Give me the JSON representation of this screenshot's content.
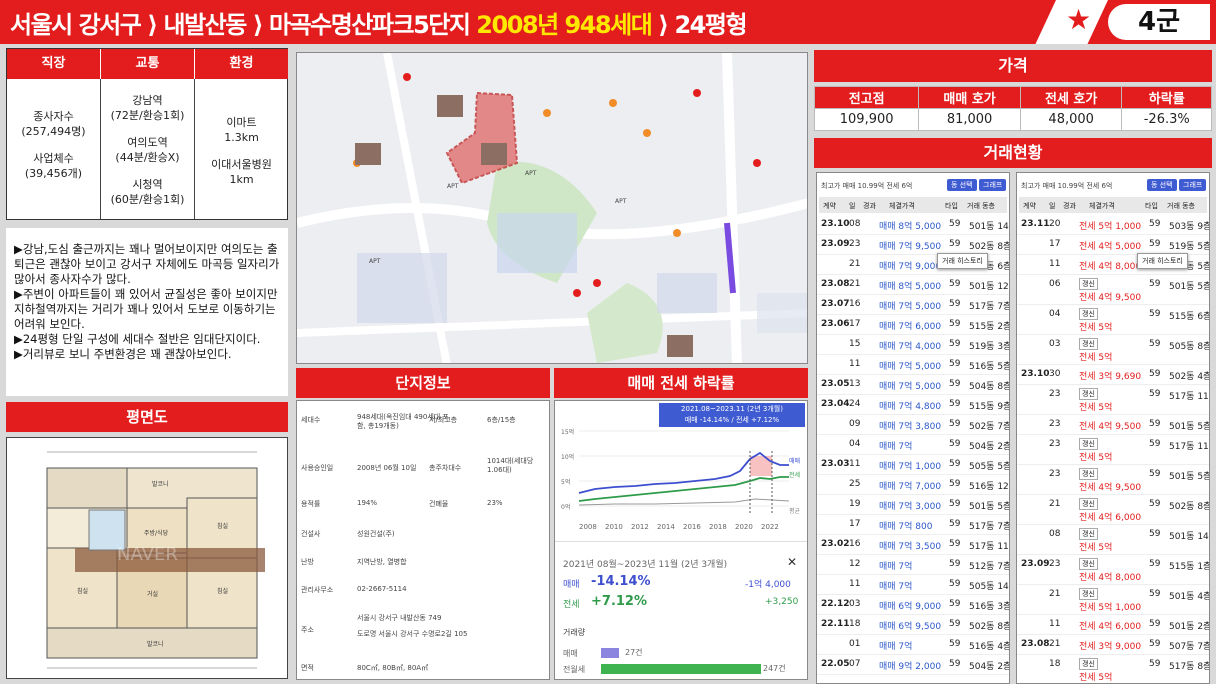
{
  "header": {
    "title_prefix": "서울시 강서구 ⟩ 내발산동 ⟩ 마곡수명산파크5단지 ",
    "title_highlight": "2008년 948세대",
    "title_suffix": " ⟩ 24평형",
    "group": "4군",
    "star": "★"
  },
  "colors": {
    "accent": "#e31d1d",
    "highlight": "#ffe800",
    "trade": "#2b57c9",
    "rent": "#1e8a3a"
  },
  "location": {
    "headers": [
      "직장",
      "교통",
      "환경"
    ],
    "work": [
      "종사자수",
      "(257,494명)",
      "사업체수",
      "(39,456개)"
    ],
    "transit": [
      "강남역",
      "(72분/환승1회)",
      "여의도역",
      "(44분/환승X)",
      "시청역",
      "(60분/환승1회)"
    ],
    "env": [
      "이마트",
      "1.3km",
      "이대서울병원",
      "1km"
    ]
  },
  "comment": "▶강남,도심 출근까지는 꽤나 멀어보이지만 여의도는 출퇴근은 괜찮아 보이고 강서구 자체에도 마곡등 일자리가 많아서 종사자수가 많다.\n▶주변이 아파트들이 꽤 있어서 균질성은 좋아 보이지만 지하철역까지는 거리가 꽤나 있어서 도보로 이동하기는 어려워 보인다.\n▶24평형 단일 구성에 세대수 절반은 임대단지이다.\n▶거리뷰로 보니 주변환경은 꽤 괜찮아보인다.",
  "floorplan": {
    "title": "평면도",
    "watermark": "NAVER"
  },
  "complex": {
    "title": "단지정보",
    "rows": [
      {
        "k": "세대수",
        "v": "948세대(옥진임대 490세대 포함, 총19개동)",
        "k2": "저/최고층",
        "v2": "6층/15층"
      },
      {
        "k": "사용승인일",
        "v": "2008년 06월 10일",
        "k2": "총주차대수",
        "v2": "1014대(세대당 1.06대)"
      },
      {
        "k": "용적률",
        "v": "194%",
        "k2": "건폐율",
        "v2": "23%"
      },
      {
        "k": "건설사",
        "v": "성원건설(주)",
        "k2": "",
        "v2": ""
      },
      {
        "k": "난방",
        "v": "지역난방, 열병합",
        "k2": "",
        "v2": ""
      },
      {
        "k": "관리사무소",
        "v": "02-2667-5114",
        "k2": "",
        "v2": ""
      },
      {
        "k": "주소",
        "v": "서울시 강서구 내발산동 749",
        "v3": "도로명 서울시 강서구 수명로2길 105",
        "k2": "",
        "v2": ""
      },
      {
        "k": "면적",
        "v": "80C㎡, 80B㎡, 80A㎡",
        "k2": "",
        "v2": ""
      }
    ]
  },
  "decline": {
    "title": "매매 전세 하락률",
    "period_badge": "2021.08~2023.11 (2년 3개월)",
    "badge_line2": "매매 -14.14% / 전세 +7.12%",
    "years": [
      "2008",
      "2010",
      "2012",
      "2014",
      "2016",
      "2018",
      "2020",
      "2022"
    ],
    "ylabels": [
      "15억",
      "10억",
      "5억",
      "0억"
    ],
    "legend": [
      "매매",
      "전세",
      "평균"
    ],
    "period": "2021년 08월~2023년 11월 (2년 3개월)",
    "close": "✕",
    "sale_label": "매매",
    "sale_pct": "-14.14%",
    "sale_amt": "-1억 4,000",
    "rent_label": "전세",
    "rent_pct": "+7.12%",
    "rent_amt": "+3,250",
    "volume_title": "거래량",
    "vol": [
      {
        "label": "매매",
        "count": "27건",
        "frac": 0.11
      },
      {
        "label": "전월세",
        "count": "247건",
        "frac": 1.0
      }
    ]
  },
  "price": {
    "title": "가격",
    "headers": [
      "전고점",
      "매매 호가",
      "전세 호가",
      "하락률"
    ],
    "values": [
      "109,900",
      "81,000",
      "48,000",
      "-26.3%"
    ]
  },
  "deals": {
    "title": "거래현황",
    "left": {
      "top": "최고가 매매 10.99억  전세 6억",
      "btns": [
        "동 선택",
        "그래프"
      ],
      "cols": [
        "계약",
        "일",
        "경과",
        "체결가격",
        "타입",
        "거래 동층"
      ],
      "tip": "거래 히스토리",
      "rows": [
        [
          "23.10",
          "08",
          "",
          "매매 8억 5,000",
          "59",
          "501동 14층"
        ],
        [
          "23.09",
          "23",
          "",
          "매매 7억 9,500",
          "59",
          "502동 8층"
        ],
        [
          "",
          "21",
          "",
          "매매 7억 9,000",
          "59",
          "506동 6층"
        ],
        [
          "23.08",
          "21",
          "",
          "매매 8억 5,000",
          "59",
          "501동 12층"
        ],
        [
          "23.07",
          "16",
          "",
          "매매 7억 5,000",
          "59",
          "517동 7층"
        ],
        [
          "23.06",
          "17",
          "",
          "매매 7억 6,000",
          "59",
          "515동 2층"
        ],
        [
          "",
          "15",
          "",
          "매매 7억 4,000",
          "59",
          "519동 3층"
        ],
        [
          "",
          "11",
          "",
          "매매 7억 5,000",
          "59",
          "516동 5층"
        ],
        [
          "23.05",
          "13",
          "",
          "매매 7억 5,000",
          "59",
          "504동 8층"
        ],
        [
          "23.04",
          "24",
          "",
          "매매 7억 4,800",
          "59",
          "515동 9층"
        ],
        [
          "",
          "09",
          "",
          "매매 7억 3,800",
          "59",
          "502동 7층"
        ],
        [
          "",
          "04",
          "",
          "매매 7억",
          "59",
          "504동 2층"
        ],
        [
          "23.03",
          "11",
          "",
          "매매 7억 1,000",
          "59",
          "505동 5층"
        ],
        [
          "",
          "25",
          "",
          "매매 7억 7,000",
          "59",
          "516동 12층"
        ],
        [
          "",
          "19",
          "",
          "매매 7억 3,000",
          "59",
          "501동 5층"
        ],
        [
          "",
          "17",
          "",
          "매매 7억 800",
          "59",
          "517동 7층"
        ],
        [
          "23.02",
          "16",
          "",
          "매매 7억 3,500",
          "59",
          "517동 11층"
        ],
        [
          "",
          "12",
          "",
          "매매 7억",
          "59",
          "512동 7층"
        ],
        [
          "",
          "11",
          "",
          "매매 7억",
          "59",
          "505동 14층"
        ],
        [
          "22.12",
          "03",
          "",
          "매매 6억 9,000",
          "59",
          "516동 3층"
        ],
        [
          "22.11",
          "18",
          "",
          "매매 6억 9,500",
          "59",
          "502동 8층"
        ],
        [
          "",
          "01",
          "",
          "매매 7억",
          "59",
          "516동 4층"
        ],
        [
          "22.05",
          "07",
          "",
          "매매 9억 2,000",
          "59",
          "504동 2층"
        ]
      ]
    },
    "right": {
      "top": "최고가 매매 10.99억  전세 6억",
      "btns": [
        "동 선택",
        "그래프"
      ],
      "cols": [
        "계약",
        "일",
        "경과",
        "체결가격",
        "타입",
        "거래 동층"
      ],
      "tip": "거래 히스토리",
      "rows": [
        [
          "23.11",
          "20",
          "",
          "전세 5억 1,000",
          "59",
          "503동 9층"
        ],
        [
          "",
          "17",
          "",
          "전세 4억 5,000",
          "59",
          "519동 5층"
        ],
        [
          "",
          "11",
          "",
          "전세 4억 8,000",
          "59",
          "501동 5층"
        ],
        [
          "",
          "06",
          "",
          "갱신 전세 4억 9,500",
          "59",
          "501동 5층"
        ],
        [
          "",
          "04",
          "",
          "갱신 전세 5억",
          "59",
          "515동 6층"
        ],
        [
          "",
          "03",
          "",
          "갱신 전세 5억",
          "59",
          "505동 8층"
        ],
        [
          "23.10",
          "30",
          "",
          "전세 3억 9,690",
          "59",
          "502동 4층"
        ],
        [
          "",
          "23",
          "",
          "갱신 전세 5억",
          "59",
          "517동 11층"
        ],
        [
          "",
          "23",
          "",
          "전세 4억 9,500",
          "59",
          "501동 5층"
        ],
        [
          "",
          "23",
          "",
          "갱신 전세 5억",
          "59",
          "517동 11층"
        ],
        [
          "",
          "23",
          "",
          "갱신 전세 4억 9,500",
          "59",
          "501동 5층"
        ],
        [
          "",
          "21",
          "",
          "갱신 전세 4억 6,000",
          "59",
          "502동 8층"
        ],
        [
          "",
          "08",
          "",
          "갱신 전세 5억",
          "59",
          "501동 14층"
        ],
        [
          "23.09",
          "23",
          "",
          "갱신 전세 4억 8,000",
          "59",
          "515동 1층"
        ],
        [
          "",
          "21",
          "",
          "갱신 전세 5억 1,000",
          "59",
          "501동 4층"
        ],
        [
          "",
          "11",
          "",
          "전세 4억 6,000",
          "59",
          "501동 2층"
        ],
        [
          "23.08",
          "21",
          "",
          "전세 3억 9,000",
          "59",
          "507동 7층"
        ],
        [
          "",
          "18",
          "",
          "갱신 전세 5억",
          "59",
          "517동 8층"
        ]
      ]
    }
  },
  "map": {
    "labels": [
      "APT",
      "APT",
      "APT",
      "APT"
    ]
  }
}
